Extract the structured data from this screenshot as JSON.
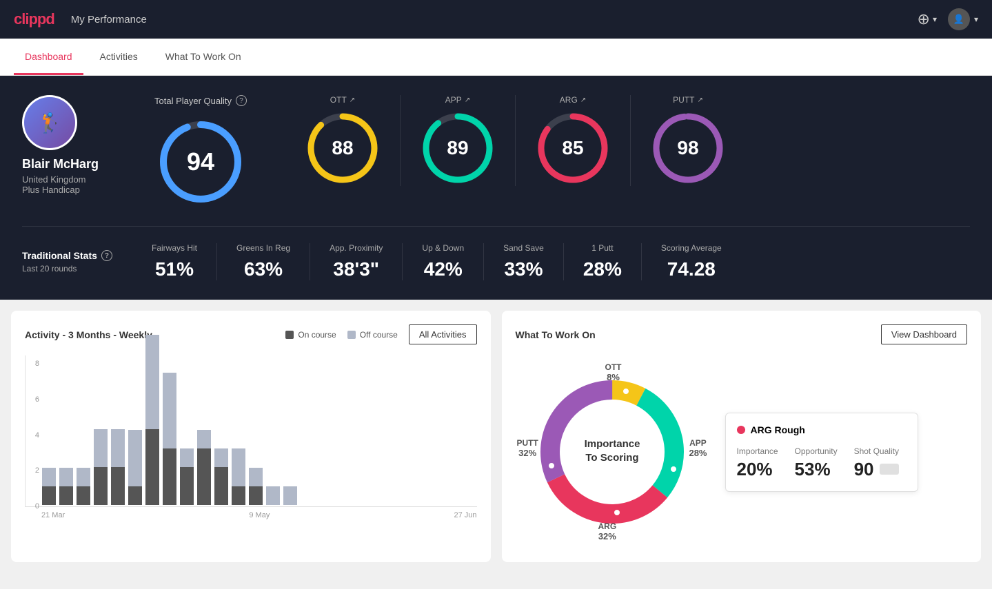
{
  "app": {
    "logo": "clippd",
    "nav_title": "My Performance"
  },
  "tabs": [
    {
      "label": "Dashboard",
      "active": true
    },
    {
      "label": "Activities",
      "active": false
    },
    {
      "label": "What To Work On",
      "active": false
    }
  ],
  "player": {
    "name": "Blair McHarg",
    "country": "United Kingdom",
    "handicap": "Plus Handicap"
  },
  "total_pq": {
    "label": "Total Player Quality",
    "value": "94",
    "pct": 94
  },
  "metrics": [
    {
      "label": "OTT",
      "value": "88",
      "pct": 88,
      "color_class": "c-yellow"
    },
    {
      "label": "APP",
      "value": "89",
      "pct": 89,
      "color_class": "c-teal"
    },
    {
      "label": "ARG",
      "value": "85",
      "pct": 85,
      "color_class": "c-pink"
    },
    {
      "label": "PUTT",
      "value": "98",
      "pct": 98,
      "color_class": "c-purple"
    }
  ],
  "stats": {
    "label": "Traditional Stats",
    "sublabel": "Last 20 rounds",
    "items": [
      {
        "name": "Fairways Hit",
        "value": "51%"
      },
      {
        "name": "Greens In Reg",
        "value": "63%"
      },
      {
        "name": "App. Proximity",
        "value": "38'3\""
      },
      {
        "name": "Up & Down",
        "value": "42%"
      },
      {
        "name": "Sand Save",
        "value": "33%"
      },
      {
        "name": "1 Putt",
        "value": "28%"
      },
      {
        "name": "Scoring Average",
        "value": "74.28"
      }
    ]
  },
  "activity_chart": {
    "title": "Activity - 3 Months - Weekly",
    "legend": [
      {
        "label": "On course",
        "color": "#555"
      },
      {
        "label": "Off course",
        "color": "#b0b8c8"
      }
    ],
    "all_activities_btn": "All Activities",
    "y_labels": [
      "8",
      "6",
      "4",
      "2",
      "0"
    ],
    "x_labels": [
      "21 Mar",
      "9 May",
      "27 Jun"
    ],
    "bars": [
      {
        "dark": 1,
        "light": 1
      },
      {
        "dark": 1,
        "light": 1
      },
      {
        "dark": 1,
        "light": 1
      },
      {
        "dark": 2,
        "light": 2
      },
      {
        "dark": 2,
        "light": 2
      },
      {
        "dark": 1,
        "light": 3
      },
      {
        "dark": 4,
        "light": 5
      },
      {
        "dark": 3,
        "light": 4
      },
      {
        "dark": 2,
        "light": 1
      },
      {
        "dark": 3,
        "light": 1
      },
      {
        "dark": 2,
        "light": 1
      },
      {
        "dark": 1,
        "light": 2
      },
      {
        "dark": 1,
        "light": 1
      },
      {
        "dark": 0,
        "light": 1
      },
      {
        "dark": 0,
        "light": 1
      }
    ]
  },
  "what_to_work_on": {
    "title": "What To Work On",
    "view_dashboard_btn": "View Dashboard",
    "donut_center": [
      "Importance",
      "To Scoring"
    ],
    "segments": [
      {
        "label": "OTT",
        "value": "8%",
        "color": "#f5c518",
        "pct": 8
      },
      {
        "label": "APP",
        "value": "28%",
        "color": "#00d4aa",
        "pct": 28
      },
      {
        "label": "ARG",
        "value": "32%",
        "color": "#e8365d",
        "pct": 32
      },
      {
        "label": "PUTT",
        "value": "32%",
        "color": "#9b59b6",
        "pct": 32
      }
    ],
    "detail": {
      "title": "ARG Rough",
      "dot_color": "#e8365d",
      "metrics": [
        {
          "name": "Importance",
          "value": "20%"
        },
        {
          "name": "Opportunity",
          "value": "53%"
        },
        {
          "name": "Shot Quality",
          "value": "90"
        }
      ]
    }
  }
}
